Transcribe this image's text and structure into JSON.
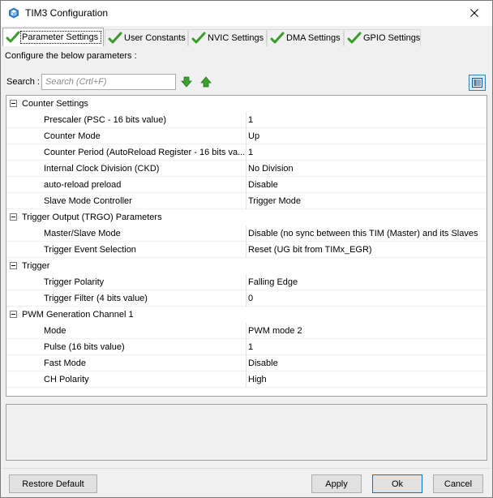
{
  "window": {
    "title": "TIM3 Configuration"
  },
  "tabs": [
    {
      "label": "Parameter Settings",
      "active": true
    },
    {
      "label": "User Constants",
      "active": false
    },
    {
      "label": "NVIC Settings",
      "active": false
    },
    {
      "label": "DMA Settings",
      "active": false
    },
    {
      "label": "GPIO Settings",
      "active": false
    }
  ],
  "panel": {
    "description": "Configure the below parameters :",
    "search_label": "Search :",
    "search_placeholder": "Search (Crtl+F)"
  },
  "categories": [
    {
      "label": "Counter Settings",
      "params": [
        {
          "name": "Prescaler (PSC - 16 bits value)",
          "value": "1"
        },
        {
          "name": "Counter Mode",
          "value": "Up"
        },
        {
          "name": "Counter Period (AutoReload Register - 16 bits va...",
          "value": "1"
        },
        {
          "name": "Internal Clock Division (CKD)",
          "value": "No Division"
        },
        {
          "name": "auto-reload preload",
          "value": "Disable"
        },
        {
          "name": "Slave Mode Controller",
          "value": "Trigger Mode"
        }
      ]
    },
    {
      "label": "Trigger Output (TRGO) Parameters",
      "params": [
        {
          "name": "Master/Slave Mode",
          "value": "Disable (no sync between this TIM (Master) and its Slaves"
        },
        {
          "name": "Trigger Event Selection",
          "value": "Reset (UG bit from TIMx_EGR)"
        }
      ]
    },
    {
      "label": "Trigger",
      "params": [
        {
          "name": "Trigger Polarity",
          "value": "Falling Edge"
        },
        {
          "name": "Trigger Filter (4 bits value)",
          "value": "0"
        }
      ]
    },
    {
      "label": "PWM Generation Channel 1",
      "params": [
        {
          "name": "Mode",
          "value": "PWM mode 2"
        },
        {
          "name": "Pulse (16 bits value)",
          "value": "1"
        },
        {
          "name": "Fast Mode",
          "value": "Disable"
        },
        {
          "name": "CH Polarity",
          "value": "High"
        }
      ]
    }
  ],
  "buttons": {
    "restore_default": "Restore Default",
    "apply": "Apply",
    "ok": "Ok",
    "cancel": "Cancel"
  },
  "colors": {
    "check_green": "#3a9a2a",
    "arrow_green": "#3aa02e",
    "app_icon_blue": "#2b79c2"
  },
  "icons": {
    "title": "cube-icon",
    "close": "close-icon",
    "tab": "checkmark-icon",
    "search_down": "arrow-down-icon",
    "search_up": "arrow-up-icon",
    "view": "list-view-icon",
    "collapse": "collapse-minus-icon"
  }
}
